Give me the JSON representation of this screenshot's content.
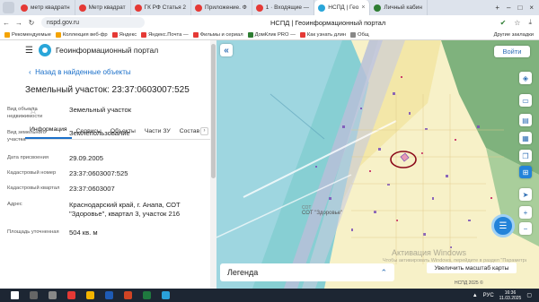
{
  "browser": {
    "tabs": [
      {
        "label": "метр квадратн",
        "color": "#e53935",
        "active": false
      },
      {
        "label": "Метр квадрат",
        "color": "#e53935",
        "active": false
      },
      {
        "label": "ГК РФ Статья 2",
        "color": "#e53935",
        "active": false
      },
      {
        "label": "Приложение. Ф",
        "color": "#e53935",
        "active": false
      },
      {
        "label": "1 · Входящие —",
        "color": "#e53935",
        "active": false
      },
      {
        "label": "НСПД | Гео",
        "color": "#2aa6d9",
        "active": true
      },
      {
        "label": "Личный кабин",
        "color": "#2e7d32",
        "active": false
      }
    ],
    "url": "nspd.gov.ru",
    "page_title": "НСПД | Геоинформационный портал",
    "bookmarks": [
      "Рекомендуемые",
      "Коллекция веб-фр",
      "Яндекс",
      "Яндекс.Почта —",
      "Фильмы и сериал",
      "ДомКлик PRO —",
      "Как узнать длин",
      "Общ"
    ],
    "other_bookmarks": "Другие закладки"
  },
  "portal": {
    "name": "Геоинформационный портал",
    "back_link": "Назад в найденные объекты",
    "object_title": "Земельный участок: 23:37:0603007:525",
    "tabs": [
      "Информация",
      "Сервисы",
      "Объекты",
      "Части ЗУ",
      "Состав"
    ],
    "active_tab": "Информация",
    "rows": [
      {
        "key": "Вид объекта недвижимости",
        "value": "Земельный участок"
      },
      {
        "key": "Вид земельного участка",
        "value": "Землепользование"
      },
      {
        "key": "Дата присвоения",
        "value": "29.09.2005"
      },
      {
        "key": "Кадастровый номер",
        "value": "23:37:0603007:525"
      },
      {
        "key": "Кадастровый квартал",
        "value": "23:37:0603007"
      },
      {
        "key": "Адрес",
        "value": "Краснодарский край, г. Анапа, СОТ \"Здоровье\", квартал 3, участок 216"
      },
      {
        "key": "Площадь уточненная",
        "value": "504 кв. м"
      }
    ]
  },
  "map": {
    "login_button": "Войти",
    "legend_label": "Легенда",
    "scale_button": "Увеличить масштаб карты",
    "place_label": "СОТ \"Здоровье\"",
    "place_sublabel": "СОТ",
    "watermark": "Активация Windows",
    "watermark_hint": "Чтобы активировать Windows, перейдите в раздел \"Параметры\".",
    "copyright": "НСПД 2025 ©"
  },
  "taskbar": {
    "lang": "РУС",
    "time": "16:36",
    "date": "11.03.2025"
  },
  "colors": {
    "accent": "#1a6fc9",
    "parcel_outline": "#8b0a1a"
  }
}
